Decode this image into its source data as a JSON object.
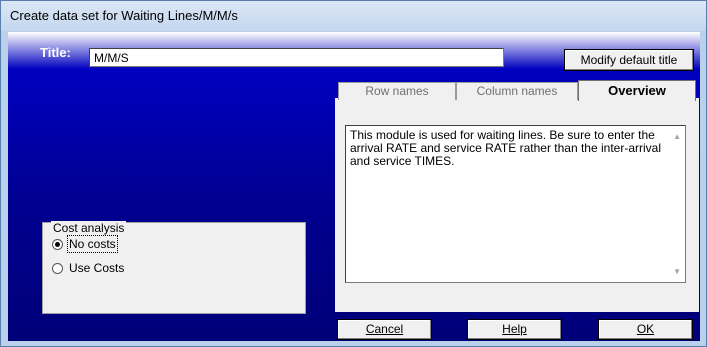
{
  "window": {
    "title": "Create data set for Waiting Lines/M/M/s"
  },
  "title_field": {
    "label": "Title:",
    "value": "M/M/S"
  },
  "buttons": {
    "modify_default_title": "Modify default title",
    "cancel": "Cancel",
    "help": "Help",
    "ok": "OK"
  },
  "tabs": [
    {
      "label": "Row names",
      "selected": false
    },
    {
      "label": "Column names",
      "selected": false
    },
    {
      "label": "Overview",
      "selected": true
    }
  ],
  "overview": {
    "text": "This module is used for waiting lines. Be sure to enter the arrival RATE and service RATE rather than the inter-arrival and service TIMES."
  },
  "cost_analysis": {
    "label": "Cost analysis",
    "options": [
      {
        "label": "No costs",
        "checked": true
      },
      {
        "label": "Use Costs",
        "checked": false
      }
    ]
  },
  "colors": {
    "client_gradient_top": "#ffffff",
    "client_gradient_bottom": "#000078",
    "titlebar": "#c4d7ef",
    "panel": "#f0f0f0"
  }
}
